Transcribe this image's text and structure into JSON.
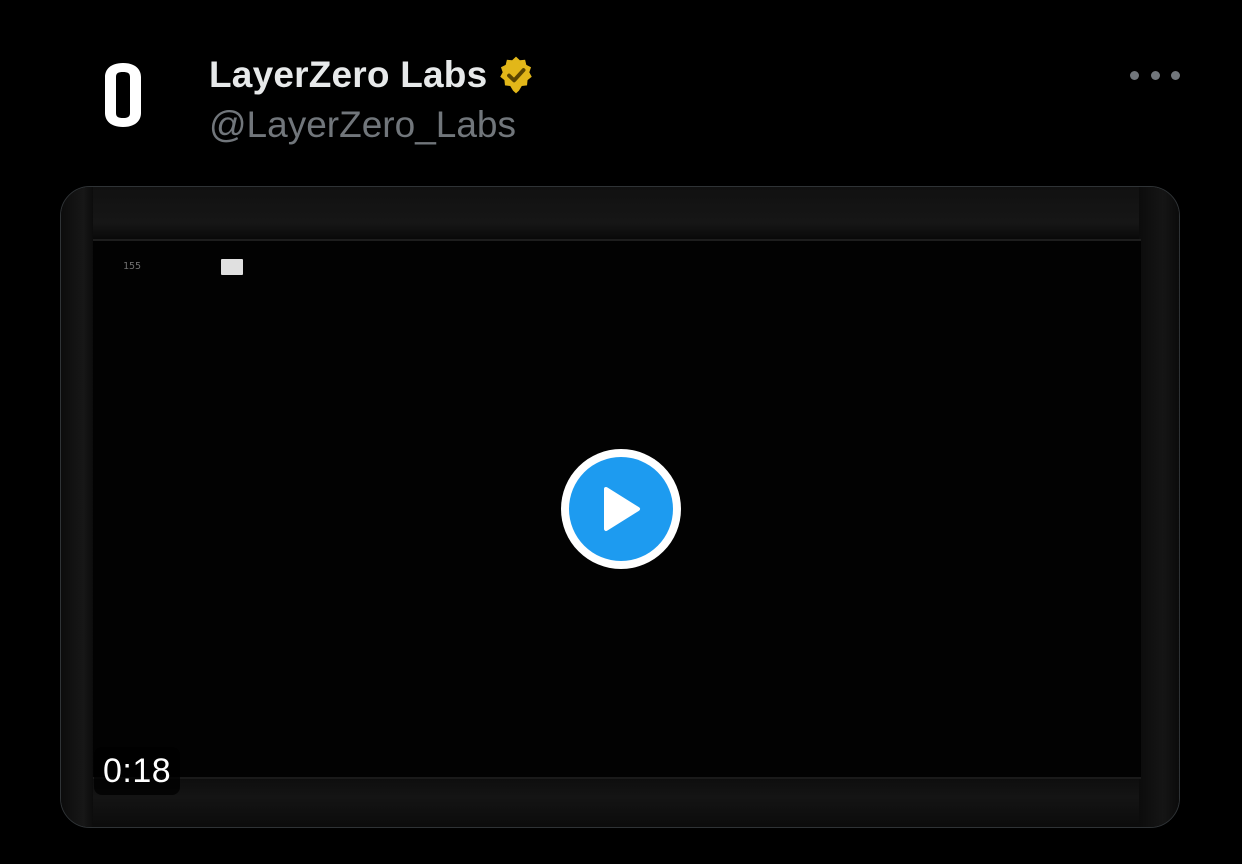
{
  "author": {
    "display_name": "LayerZero Labs",
    "handle": "@LayerZero_Labs",
    "avatar_icon": "layerzero-logo-icon",
    "verified_icon": "verified-badge-icon",
    "verified_color": "#e2b719"
  },
  "actions": {
    "more_icon": "more-options-icon"
  },
  "media": {
    "type": "video",
    "duration": "0:18",
    "frame_counter": "155",
    "play_icon": "play-icon",
    "accent_color": "#1d9bf0"
  }
}
